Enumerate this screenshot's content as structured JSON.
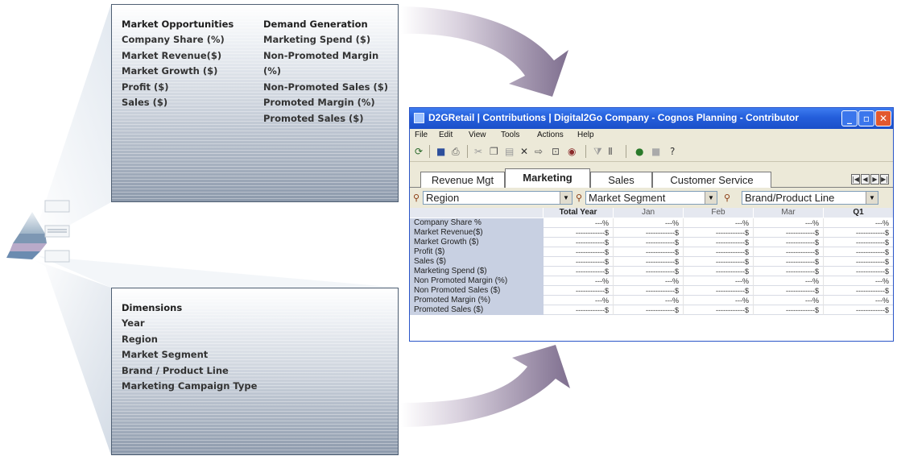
{
  "market_panel": {
    "col1": {
      "heading": "Market Opportunities",
      "items": [
        "Company Share (%)",
        "Market Revenue($)",
        "Market Growth ($)",
        "Profit ($)",
        "Sales ($)"
      ]
    },
    "col2": {
      "heading": "Demand Generation",
      "items": [
        "Marketing Spend ($)",
        "Non-Promoted Margin (%)",
        "Non-Promoted Sales ($)",
        "Promoted Margin (%)",
        "Promoted Sales ($)"
      ]
    }
  },
  "dimensions_panel": {
    "heading": "Dimensions",
    "items": [
      "Year",
      "Region",
      "Market Segment",
      "Brand / Product Line",
      "Marketing Campaign Type"
    ]
  },
  "window": {
    "title": "D2GRetail | Contributions | Digital2Go Company - Cognos Planning - Contributor",
    "controls": {
      "minimize": "_",
      "maximize": "▫",
      "close": "✕"
    },
    "menu": [
      "File",
      "Edit",
      "View",
      "Tools",
      "Actions",
      "Help"
    ],
    "toolbar_icons": [
      "refresh-icon",
      "save-icon",
      "print-icon",
      "cut-icon",
      "copy-icon",
      "paste-icon",
      "delete-icon",
      "import-icon",
      "export-icon",
      "target-icon",
      "filter-icon",
      "chart-icon",
      "go-icon",
      "stop-icon",
      "help-icon"
    ],
    "tabs": [
      "Revenue Mgt",
      "Marketing",
      "Sales",
      "Customer Service"
    ],
    "active_tab": "Marketing",
    "dimension_selectors": [
      "Region",
      "Market Segment",
      "Brand/Product Line"
    ],
    "grid": {
      "columns": [
        "Total Year",
        "Jan",
        "Feb",
        "Mar",
        "Q1"
      ],
      "rows": [
        {
          "label": "Company Share %",
          "cells": [
            "---%",
            "---%",
            "---%",
            "---%",
            "---%"
          ]
        },
        {
          "label": "Market Revenue($)",
          "cells": [
            "------------$",
            "------------$",
            "------------$",
            "------------$",
            "------------$"
          ]
        },
        {
          "label": "Market Growth ($)",
          "cells": [
            "------------$",
            "------------$",
            "------------$",
            "------------$",
            "------------$"
          ]
        },
        {
          "label": "Profit ($)",
          "cells": [
            "------------$",
            "------------$",
            "------------$",
            "------------$",
            "------------$"
          ]
        },
        {
          "label": "Sales ($)",
          "cells": [
            "------------$",
            "------------$",
            "------------$",
            "------------$",
            "------------$"
          ]
        },
        {
          "label": "Marketing Spend ($)",
          "cells": [
            "------------$",
            "------------$",
            "------------$",
            "------------$",
            "------------$"
          ]
        },
        {
          "label": "Non Promoted Margin (%)",
          "cells": [
            "---%",
            "---%",
            "---%",
            "---%",
            "---%"
          ]
        },
        {
          "label": "Non Promoted Sales ($)",
          "cells": [
            "------------$",
            "------------$",
            "------------$",
            "------------$",
            "------------$"
          ]
        },
        {
          "label": "Promoted Margin (%)",
          "cells": [
            "---%",
            "---%",
            "---%",
            "---%",
            "---%"
          ]
        },
        {
          "label": "Promoted Sales ($)",
          "cells": [
            "------------$",
            "------------$",
            "------------$",
            "------------$",
            "------------$"
          ]
        }
      ]
    }
  },
  "colors": {
    "titlebar": "#245edb",
    "arrow": "#9a8aa6",
    "panel_edge": "#4f5f73",
    "row_label_bg": "#c8d0e2"
  }
}
